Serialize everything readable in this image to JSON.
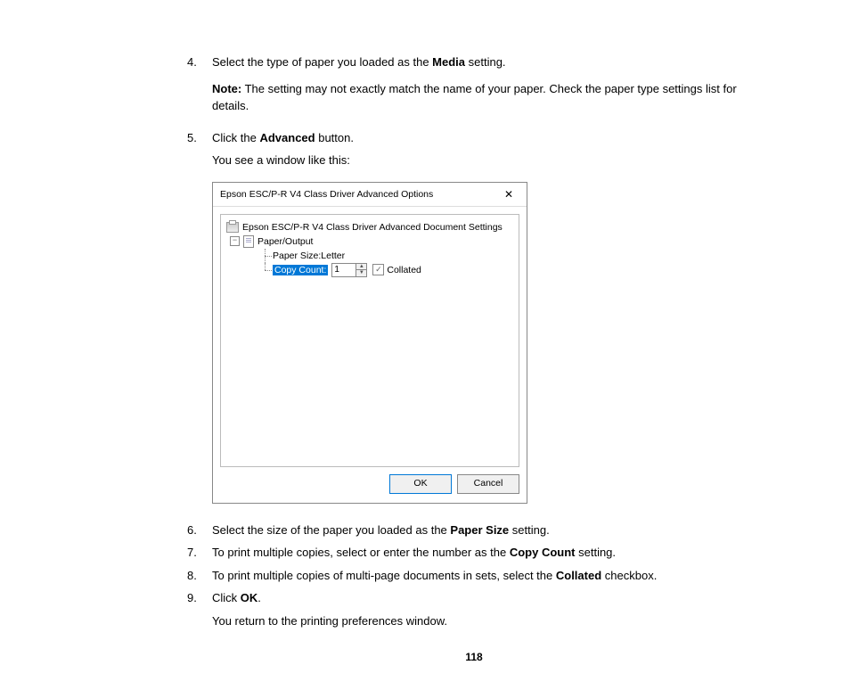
{
  "steps": {
    "s4": {
      "num": "4.",
      "pre": "Select the type of paper you loaded as the ",
      "bold": "Media",
      "post": " setting.",
      "note_label": "Note:",
      "note_text": " The setting may not exactly match the name of your paper. Check the paper type settings list for details."
    },
    "s5": {
      "num": "5.",
      "pre": "Click the ",
      "bold": "Advanced",
      "post": " button.",
      "sub": "You see a window like this:"
    },
    "s6": {
      "num": "6.",
      "pre": "Select the size of the paper you loaded as the ",
      "bold": "Paper Size",
      "post": " setting."
    },
    "s7": {
      "num": "7.",
      "pre": "To print multiple copies, select or enter the number as the ",
      "bold": "Copy Count",
      "post": " setting."
    },
    "s8": {
      "num": "8.",
      "pre": "To print multiple copies of multi-page documents in sets, select the ",
      "bold": "Collated",
      "post": " checkbox."
    },
    "s9": {
      "num": "9.",
      "pre": "Click ",
      "bold": "OK",
      "post": ".",
      "sub": "You return to the printing preferences window."
    }
  },
  "dialog": {
    "title": "Epson ESC/P-R V4 Class Driver Advanced Options",
    "tree": {
      "root": "Epson ESC/P-R V4 Class Driver Advanced Document Settings",
      "paper_output": "Paper/Output",
      "paper_size_label": "Paper Size: ",
      "paper_size_value": "Letter",
      "copy_count_label": "Copy Count:",
      "copy_count_value": "1",
      "collated_label": "Collated"
    },
    "ok": "OK",
    "cancel": "Cancel"
  },
  "page_number": "118"
}
